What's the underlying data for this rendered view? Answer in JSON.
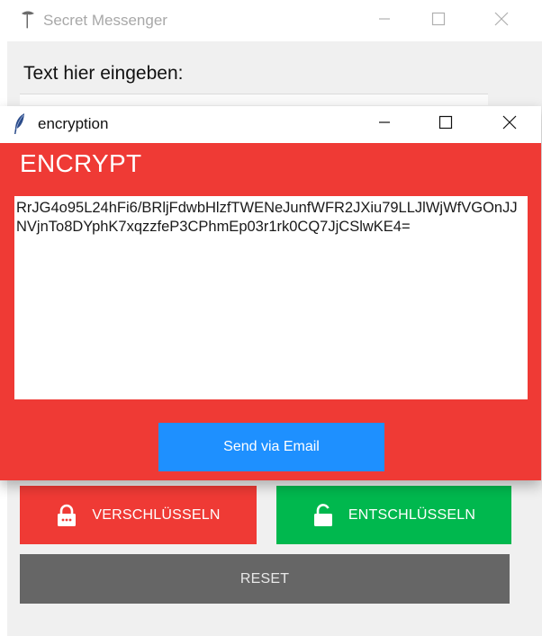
{
  "back_window": {
    "title": "Secret Messenger",
    "text_label": "Text hier eingeben:",
    "buttons": {
      "encrypt_label": "VERSCHLÜSSELN",
      "decrypt_label": "ENTSCHLÜSSELN",
      "reset_label": "RESET"
    }
  },
  "front_window": {
    "title": "encryption",
    "heading": "ENCRYPT",
    "encrypted_text": "RrJG4o95L24hFi6/BRljFdwbHlzfTWENeJunfWFR2JXiu79LLJlWjWfVGOnJJNVjnTo8DYphK7xqzzfeP3CPhmEp03r1rk0CQ7JjCSlwKE4=",
    "send_label": "Send via Email"
  },
  "colors": {
    "encrypt_red": "#ef3a35",
    "decrypt_green": "#00b84e",
    "reset_gray": "#666666",
    "send_blue": "#1e90ff"
  },
  "icons": {
    "back_app_icon": "feather-icon",
    "front_app_icon": "feather-icon",
    "encrypt_icon": "padlock-closed-icon",
    "decrypt_icon": "padlock-open-icon"
  }
}
